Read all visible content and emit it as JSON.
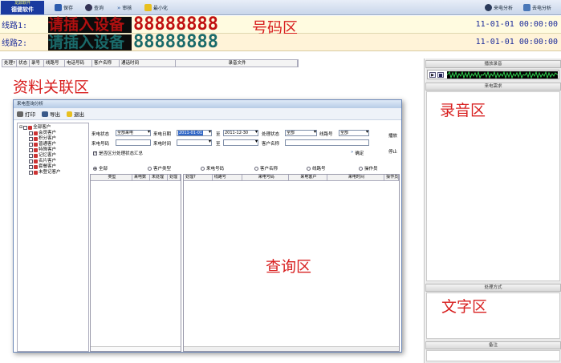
{
  "app": {
    "logo_line1": "龙鼎软件",
    "logo_line2": "德健软件"
  },
  "toolbar": {
    "save": "保存",
    "query": "查询",
    "audit": "审核",
    "minimize": "最小化",
    "incoming_analysis": "来电分析",
    "outgoing_analysis": "去电分析"
  },
  "lines": [
    {
      "label": "线路1:",
      "prompt": "请插入设备",
      "digits": "88888888",
      "time": "11-01-01 00:00:00"
    },
    {
      "label": "线路2:",
      "prompt": "请插入设备",
      "digits": "88888888",
      "time": "11-01-01 00:00:00"
    }
  ],
  "zones": {
    "number_zone": "号码区",
    "data_zone": "资料关联区",
    "recording_zone": "录音区",
    "query_zone": "查询区",
    "text_zone": "文字区"
  },
  "grid": {
    "columns": [
      "处理?",
      "状态",
      "录号",
      "线路号",
      "电话号码",
      "客户名称",
      "通话时间",
      "录音文件"
    ]
  },
  "right_panel": {
    "playback_header": "播放录音",
    "incoming_header": "来电需求",
    "handling_header": "处理方式",
    "remark_header": "备注"
  },
  "dialog": {
    "title": "来电查询分析",
    "print": "打印",
    "export": "导出",
    "exit": "退出",
    "tree": [
      "全部客户",
      "会员客户",
      "积分客户",
      "普通客户",
      "特殊客户",
      "记忆客户",
      "名片客户",
      "套餐客户",
      "未登记客户"
    ],
    "filters": {
      "incoming_status_label": "来电状态",
      "incoming_status_value": "全部来电",
      "incoming_date_label": "来电日期",
      "date_from": "2011-01-01",
      "to1": "至",
      "date_to": "2011-12-30",
      "handle_status_label": "处理状态",
      "handle_status_value": "全部",
      "line_no_label": "线路号",
      "line_no_value": "全部",
      "phone_label": "来电号码",
      "time_label": "来电时间",
      "to2": "至",
      "customer_label": "客户名称",
      "play": "播放",
      "stop": "停止",
      "confirm": "确定",
      "summary_check": "是否区分处理状态汇总"
    },
    "radios": [
      "全部",
      "客户类型",
      "来电号码",
      "客户名称",
      "线路号",
      "操作员"
    ],
    "left_cols": [
      "类型",
      "来电数",
      "未处理",
      "处理"
    ],
    "right_cols": [
      "处理?",
      "线路号",
      "来电号码",
      "来电客户",
      "来电时间",
      "操作员"
    ]
  },
  "colors": {
    "zone_label": "#d82020",
    "line_text": "#1a2a9a",
    "digits_line1": "#c01010",
    "digits_line2": "#1a6a6a"
  }
}
